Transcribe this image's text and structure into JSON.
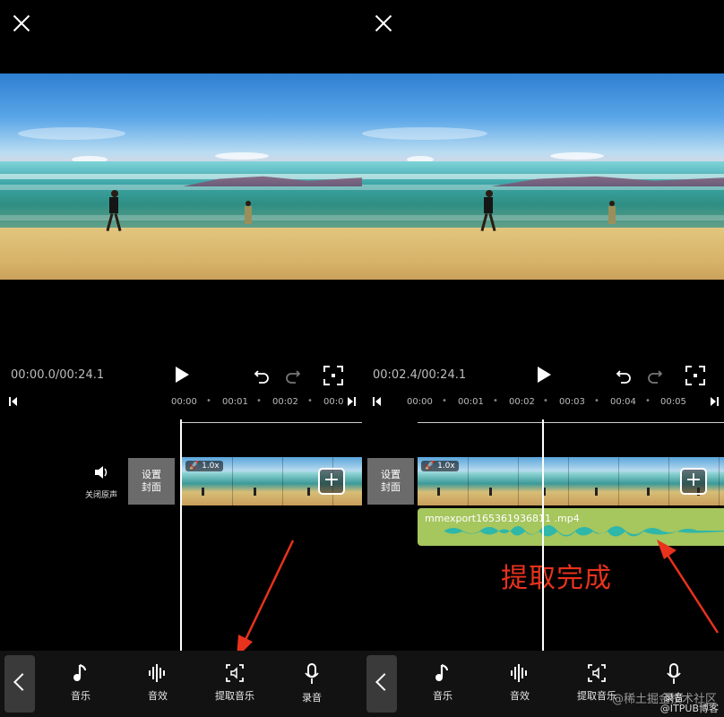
{
  "left": {
    "timecode": "00:00.0/00:24.1",
    "ruler": [
      "00:00",
      "00:01",
      "00:02",
      "00:0"
    ],
    "mute_label": "关闭原声",
    "cover_label_1": "设置",
    "cover_label_2": "封面",
    "speed": "1.0x",
    "add": "+"
  },
  "right": {
    "timecode": "00:02.4/00:24.1",
    "ruler": [
      "00:00",
      "00:01",
      "00:02",
      "00:03",
      "00:04",
      "00:05"
    ],
    "cover_label_1": "设置",
    "cover_label_2": "封面",
    "speed": "1.0x",
    "add": "+",
    "audio_name": "mmexport165361936811 .mp4",
    "annotation": "提取完成",
    "watermark": "@稀土掘金技术社区",
    "watermark2": "@ITPUB博客"
  },
  "tools": {
    "music": "音乐",
    "sfx": "音效",
    "extract": "提取音乐",
    "record": "录音"
  },
  "colors": {
    "audio_track": "#a6c65e",
    "waveform": "#2fb7a9",
    "annotation": "#e8321d"
  }
}
